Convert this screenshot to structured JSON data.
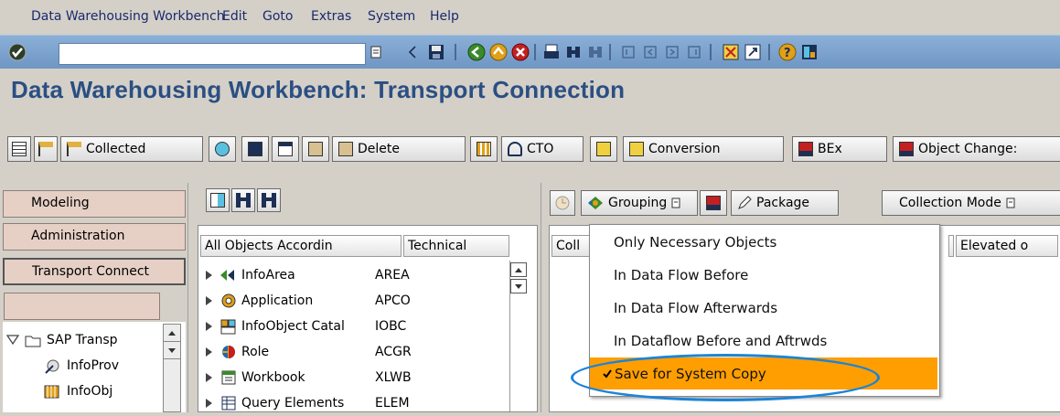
{
  "menubar": {
    "items": [
      "Data Warehousing Workbench",
      "Edit",
      "Goto",
      "Extras",
      "System",
      "Help"
    ]
  },
  "systool": {
    "command_value": "",
    "icons": [
      "enter-icon",
      "back-icon",
      "save-icon",
      "back-nav-icon",
      "exit-icon",
      "cancel-icon",
      "print-icon",
      "find-icon",
      "find-next-icon",
      "first-page-icon",
      "prev-page-icon",
      "next-page-icon",
      "last-page-icon",
      "new-session-icon",
      "shortcut-icon",
      "help-icon",
      "layout-icon"
    ]
  },
  "title": "Data Warehousing Workbench: Transport Connection",
  "apptool": {
    "collected": "Collected",
    "delete": "Delete",
    "cto": "CTO",
    "conversion": "Conversion",
    "bex": "BEx",
    "object_changes": "Object Change:"
  },
  "nav": {
    "modeling": "Modeling",
    "administration": "Administration",
    "transport": "Transport Connect",
    "tree_root": "SAP Transp",
    "tree_items": [
      "InfoProv",
      "InfoObj"
    ]
  },
  "middle": {
    "col1": "All Objects Accordin",
    "col2": "Technical",
    "rows": [
      {
        "label": "InfoArea",
        "tech": "AREA",
        "icon": "infoarea-icon"
      },
      {
        "label": "Application",
        "tech": "APCO",
        "icon": "application-icon"
      },
      {
        "label": "InfoObject Catal",
        "tech": "IOBC",
        "icon": "infoobject-catalog-icon"
      },
      {
        "label": "Role",
        "tech": "ACGR",
        "icon": "role-icon"
      },
      {
        "label": "Workbook",
        "tech": "XLWB",
        "icon": "workbook-icon"
      },
      {
        "label": "Query Elements",
        "tech": "ELEM",
        "icon": "query-elements-icon"
      }
    ]
  },
  "right": {
    "grouping": "Grouping",
    "package": "Package",
    "collection_mode": "Collection Mode",
    "col_coll": "Coll",
    "col_elevated": "Elevated o"
  },
  "popup": {
    "items": [
      "Only Necessary Objects",
      "In Data Flow Before",
      "In Data Flow Afterwards",
      "In Dataflow Before and Aftrwds",
      "Save for System Copy"
    ],
    "selected_index": 4
  },
  "colors": {
    "title": "#2b4f83",
    "highlight": "#ff9e00",
    "toolbar": "#7ea6d2",
    "nav": "#e6d0c6",
    "ellipse": "#1c84d8"
  }
}
